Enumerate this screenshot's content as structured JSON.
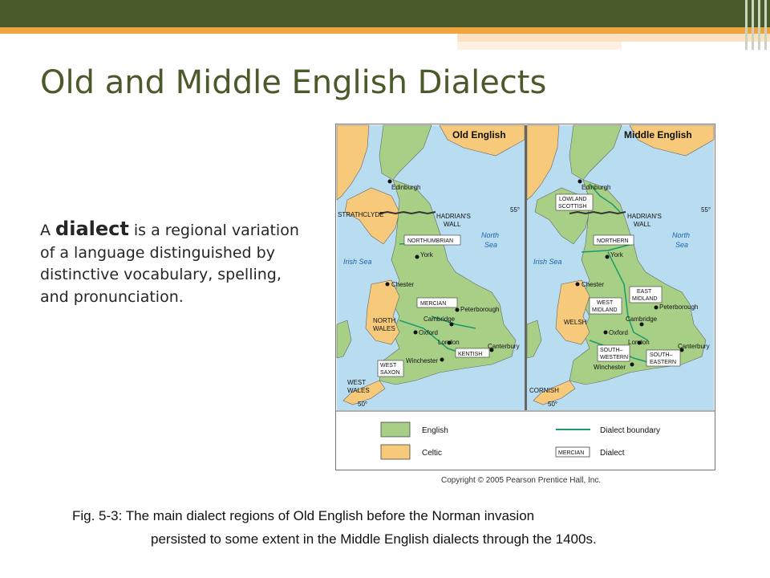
{
  "slide": {
    "title": "Old and Middle English Dialects",
    "body_prefix": "A ",
    "body_term": "dialect",
    "body_rest": " is a regional variation of a language distinguished by distinctive vocabulary, spelling, and pronunciation.",
    "caption_line1": "Fig. 5-3: The main dialect regions of Old English before the Norman invasion",
    "caption_line2": "persisted to some extent in the Middle English dialects through the 1400s."
  },
  "figure": {
    "old_title": "Old English",
    "middle_title": "Middle English",
    "old_labels": {
      "edinburgh": "Edinburgh",
      "strathclyde": "STRATHCLYDE",
      "hadrians_wall_1": "HADRIAN'S",
      "hadrians_wall_2": "WALL",
      "lat55": "55°",
      "northumbrian": "NORTHUMBRIAN",
      "north_sea_1": "North",
      "north_sea_2": "Sea",
      "irish_sea": "Irish Sea",
      "york": "York",
      "chester": "Chester",
      "mercian": "MERCIAN",
      "peterborough": "Peterborough",
      "north_wales_1": "NORTH",
      "north_wales_2": "WALES",
      "cambridge": "Cambridge",
      "oxford": "Oxford",
      "london": "London",
      "canterbury": "Canterbury",
      "kentish": "KENTISH",
      "winchester": "Winchester",
      "west_saxon_1": "WEST",
      "west_saxon_2": "SAXON",
      "west_wales_1": "WEST",
      "west_wales_2": "WALES",
      "lat50": "50°"
    },
    "middle_labels": {
      "edinburgh": "Edinburgh",
      "lowland_1": "LOWLAND",
      "lowland_2": "SCOTTISH",
      "hadrians_wall_1": "HADRIAN'S",
      "hadrians_wall_2": "WALL",
      "lat55": "55°",
      "northern": "NORTHERN",
      "north_sea_1": "North",
      "north_sea_2": "Sea",
      "irish_sea": "Irish Sea",
      "york": "York",
      "chester": "Chester",
      "east_midland_1": "EAST",
      "east_midland_2": "MIDLAND",
      "west_midland_1": "WEST",
      "west_midland_2": "MIDLAND",
      "peterborough": "Peterborough",
      "welsh": "WELSH",
      "cambridge": "Cambridge",
      "oxford": "Oxford",
      "london": "London",
      "canterbury": "Canterbury",
      "south_western_1": "SOUTH–",
      "south_western_2": "WESTERN",
      "south_eastern_1": "SOUTH–",
      "south_eastern_2": "EASTERN",
      "winchester": "Winchester",
      "cornish": "CORNISH",
      "lat50": "50°"
    },
    "legend": {
      "english": "English",
      "celtic": "Celtic",
      "dialect_boundary": "Dialect boundary",
      "dialect": "Dialect",
      "sample": "MERCIAN"
    },
    "copyright": "Copyright © 2005 Pearson Prentice Hall, Inc."
  },
  "colors": {
    "title": "#4b5a2a",
    "topbar": "#4b5a2a",
    "accent_orange": "#f0a440",
    "sea": "#b8dcf0",
    "english": "#a8cf86",
    "celtic": "#f7c97a",
    "boundary": "#1a9a6b"
  }
}
